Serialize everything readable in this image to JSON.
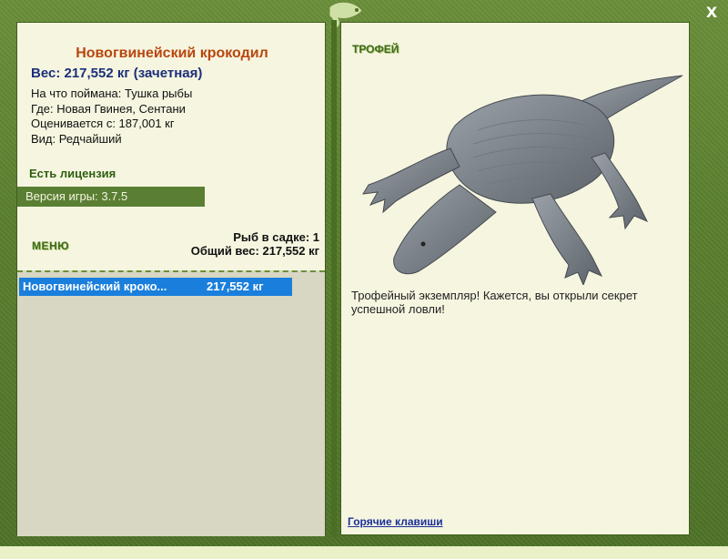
{
  "fish": {
    "name": "Новогвинейский крокодил",
    "weight_line": "Вес: 217,552 кг (зачетная)",
    "caught_on": "На что поймана: Тушка рыбы",
    "location": "Где: Новая Гвинея, Сентани",
    "valued_from": "Оценивается с: 187,001 кг",
    "kind": "Вид: Редчайший"
  },
  "license": "Есть лицензия",
  "version": "Версия игры: 3.7.5",
  "menu_label": "МЕНЮ",
  "cage": {
    "count": "Рыб в садке: 1",
    "total_weight": "Общий вес: 217,552 кг"
  },
  "list": [
    {
      "name": "Новогвинейский кроко...",
      "weight": "217,552 кг"
    }
  ],
  "trophy": {
    "label": "ТРОФЕЙ",
    "text": "Трофейный экземпляр! Кажется, вы открыли секрет успешной ловли!"
  },
  "hotkeys": "Горячие клавиши",
  "close_label": "X",
  "colors": {
    "frame_green": "#5a7f2e",
    "panel_bg": "#f6f5e0",
    "title_orange": "#b8460e",
    "weight_blue": "#1b2f7a",
    "selection_blue": "#1a7fdc"
  }
}
